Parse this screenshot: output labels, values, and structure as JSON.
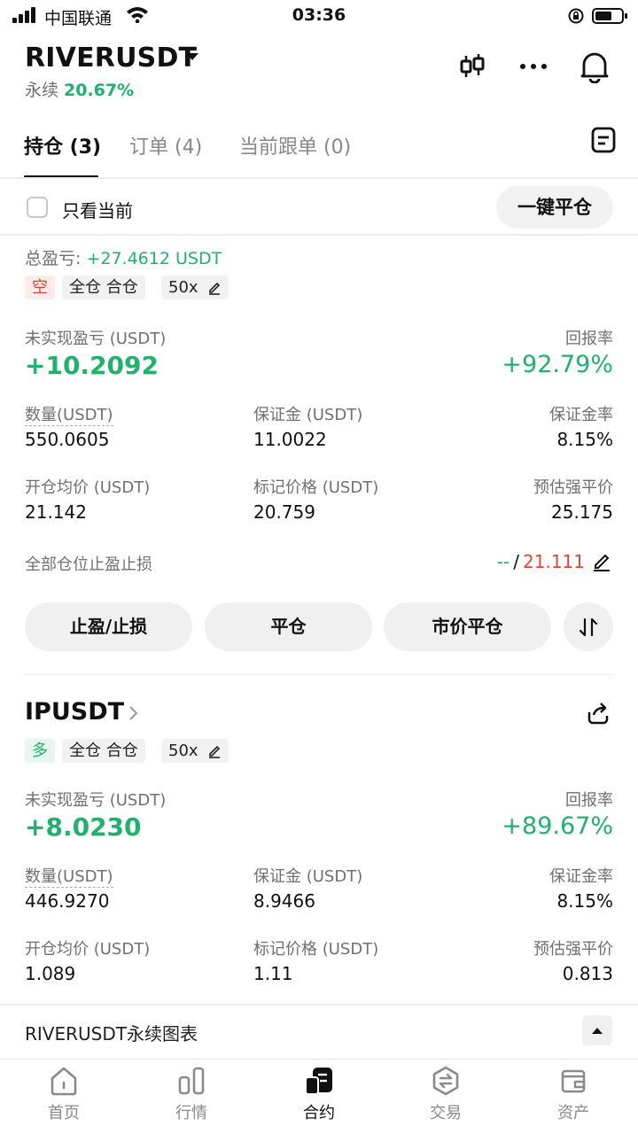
{
  "status_bar": {
    "carrier": "中国联通",
    "time": "03:36"
  },
  "header": {
    "symbol": "RIVERUSDT",
    "contract_type": "永续",
    "change_pct": "20.67%"
  },
  "tabs": [
    {
      "label": "持仓 (3)"
    },
    {
      "label": "订单 (4)"
    },
    {
      "label": "当前跟单 (0)"
    }
  ],
  "filter": {
    "only_current_label": "只看当前",
    "close_all_label": "一键平仓"
  },
  "position1": {
    "total_pnl_label": "总盈亏:",
    "total_pnl_value": "+27.4612 USDT",
    "side_tag": "空",
    "margin_mode_tag": "全仓 合仓",
    "leverage_tag": "50x",
    "unrealized_label": "未实现盈亏 (USDT)",
    "unrealized_value": "+10.2092",
    "roe_label": "回报率",
    "roe_value": "+92.79%",
    "qty_label": "数量(USDT)",
    "qty_value": "550.0605",
    "margin_label": "保证金 (USDT)",
    "margin_value": "11.0022",
    "margin_ratio_label": "保证金率",
    "margin_ratio_value": "8.15%",
    "entry_label": "开仓均价 (USDT)",
    "entry_value": "21.142",
    "mark_label": "标记价格 (USDT)",
    "mark_value": "20.759",
    "liq_label": "预估强平价",
    "liq_value": "25.175",
    "tpsl_label": "全部仓位止盈止损",
    "tp_value": "--",
    "sl_separator": "/",
    "sl_value": "21.111",
    "btn_tpsl": "止盈/止损",
    "btn_close": "平仓",
    "btn_market_close": "市价平仓"
  },
  "position2": {
    "symbol": "IPUSDT",
    "side_tag": "多",
    "margin_mode_tag": "全仓 合仓",
    "leverage_tag": "50x",
    "unrealized_label": "未实现盈亏 (USDT)",
    "unrealized_value": "+8.0230",
    "roe_label": "回报率",
    "roe_value": "+89.67%",
    "qty_label": "数量(USDT)",
    "qty_value": "446.9270",
    "margin_label": "保证金 (USDT)",
    "margin_value": "8.9466",
    "margin_ratio_label": "保证金率",
    "margin_ratio_value": "8.15%",
    "entry_label": "开仓均价 (USDT)",
    "entry_value": "1.089",
    "mark_label": "标记价格 (USDT)",
    "mark_value": "1.11",
    "liq_label": "预估强平价",
    "liq_value": "0.813"
  },
  "chart_bar": {
    "label": "RIVERUSDT永续图表"
  },
  "bottom_nav": [
    {
      "label": "首页",
      "icon": "home-icon"
    },
    {
      "label": "行情",
      "icon": "market-icon"
    },
    {
      "label": "合约",
      "icon": "futures-icon"
    },
    {
      "label": "交易",
      "icon": "trade-icon"
    },
    {
      "label": "资产",
      "icon": "wallet-icon"
    }
  ],
  "colors": {
    "up": "#20b26c",
    "down": "#e0453a"
  }
}
